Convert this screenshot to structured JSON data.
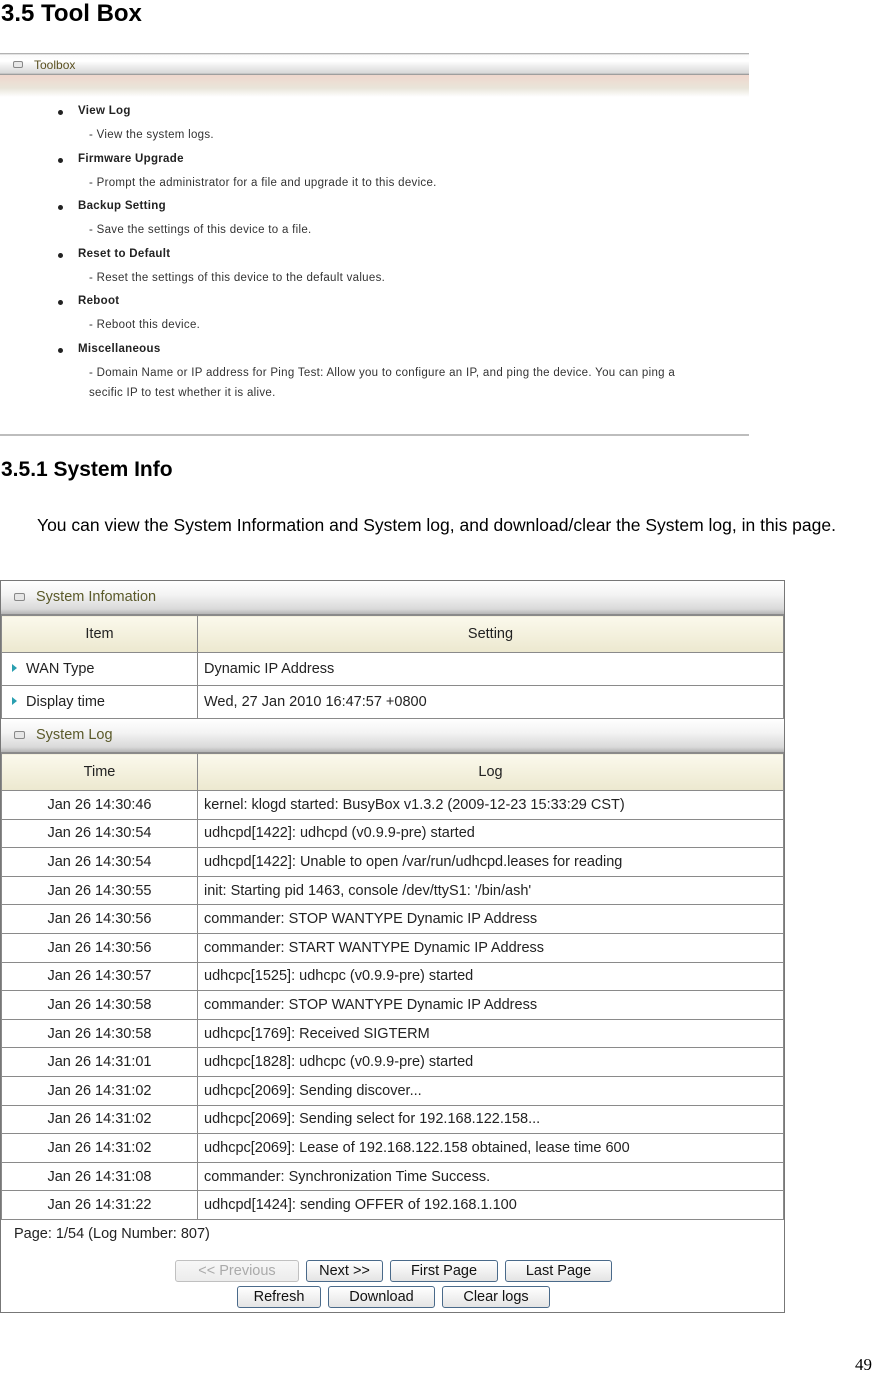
{
  "doc": {
    "heading": "3.5 Tool Box",
    "subheading": "3.5.1 System Info",
    "paragraph": "You can view the System Information and System log, and download/clear the System log, in this page.",
    "page_number": "49"
  },
  "toolbox": {
    "title": "Toolbox",
    "items": [
      {
        "label": "View Log",
        "desc": "- View the system logs."
      },
      {
        "label": "Firmware Upgrade",
        "desc": "- Prompt the administrator for a file and upgrade it to this device."
      },
      {
        "label": "Backup Setting",
        "desc": "- Save the settings of this device to a file."
      },
      {
        "label": "Reset to Default",
        "desc": "- Reset the settings of this device to the default values."
      },
      {
        "label": "Reboot",
        "desc": "- Reboot this device."
      },
      {
        "label": "Miscellaneous",
        "desc": "- Domain Name or IP address for Ping Test: Allow you to configure an IP, and ping the device. You can ping a secific IP to test whether it is alive."
      }
    ]
  },
  "system_info": {
    "title": "System Infomation",
    "columns": [
      "Item",
      "Setting"
    ],
    "rows": [
      {
        "item": "WAN Type",
        "value": "Dynamic IP Address"
      },
      {
        "item": "Display time",
        "value": "Wed, 27 Jan 2010 16:47:57 +0800"
      }
    ]
  },
  "system_log": {
    "title": "System Log",
    "columns": [
      "Time",
      "Log"
    ],
    "rows": [
      {
        "time": "Jan 26 14:30:46",
        "log": "kernel: klogd started: BusyBox v1.3.2 (2009-12-23 15:33:29 CST)"
      },
      {
        "time": "Jan 26 14:30:54",
        "log": "udhcpd[1422]: udhcpd (v0.9.9-pre) started"
      },
      {
        "time": "Jan 26 14:30:54",
        "log": "udhcpd[1422]: Unable to open /var/run/udhcpd.leases for reading"
      },
      {
        "time": "Jan 26 14:30:55",
        "log": "init: Starting pid 1463, console /dev/ttyS1: '/bin/ash'"
      },
      {
        "time": "Jan 26 14:30:56",
        "log": "commander: STOP WANTYPE Dynamic IP Address"
      },
      {
        "time": "Jan 26 14:30:56",
        "log": "commander: START WANTYPE Dynamic IP Address"
      },
      {
        "time": "Jan 26 14:30:57",
        "log": "udhcpc[1525]: udhcpc (v0.9.9-pre) started"
      },
      {
        "time": "Jan 26 14:30:58",
        "log": "commander: STOP WANTYPE Dynamic IP Address"
      },
      {
        "time": "Jan 26 14:30:58",
        "log": "udhcpc[1769]: Received SIGTERM"
      },
      {
        "time": "Jan 26 14:31:01",
        "log": "udhcpc[1828]: udhcpc (v0.9.9-pre) started"
      },
      {
        "time": "Jan 26 14:31:02",
        "log": "udhcpc[2069]: Sending discover..."
      },
      {
        "time": "Jan 26 14:31:02",
        "log": "udhcpc[2069]: Sending select for 192.168.122.158..."
      },
      {
        "time": "Jan 26 14:31:02",
        "log": "udhcpc[2069]: Lease of 192.168.122.158 obtained, lease time 600"
      },
      {
        "time": "Jan 26 14:31:08",
        "log": "commander: Synchronization Time Success."
      },
      {
        "time": "Jan 26 14:31:22",
        "log": "udhcpd[1424]: sending OFFER of 192.168.1.100"
      }
    ],
    "page_info": "Page: 1/54 (Log Number: 807)",
    "buttons": {
      "previous": "<< Previous",
      "next": "Next >>",
      "first": "First Page",
      "last": "Last Page",
      "refresh": "Refresh",
      "download": "Download",
      "clear": "Clear logs"
    }
  }
}
